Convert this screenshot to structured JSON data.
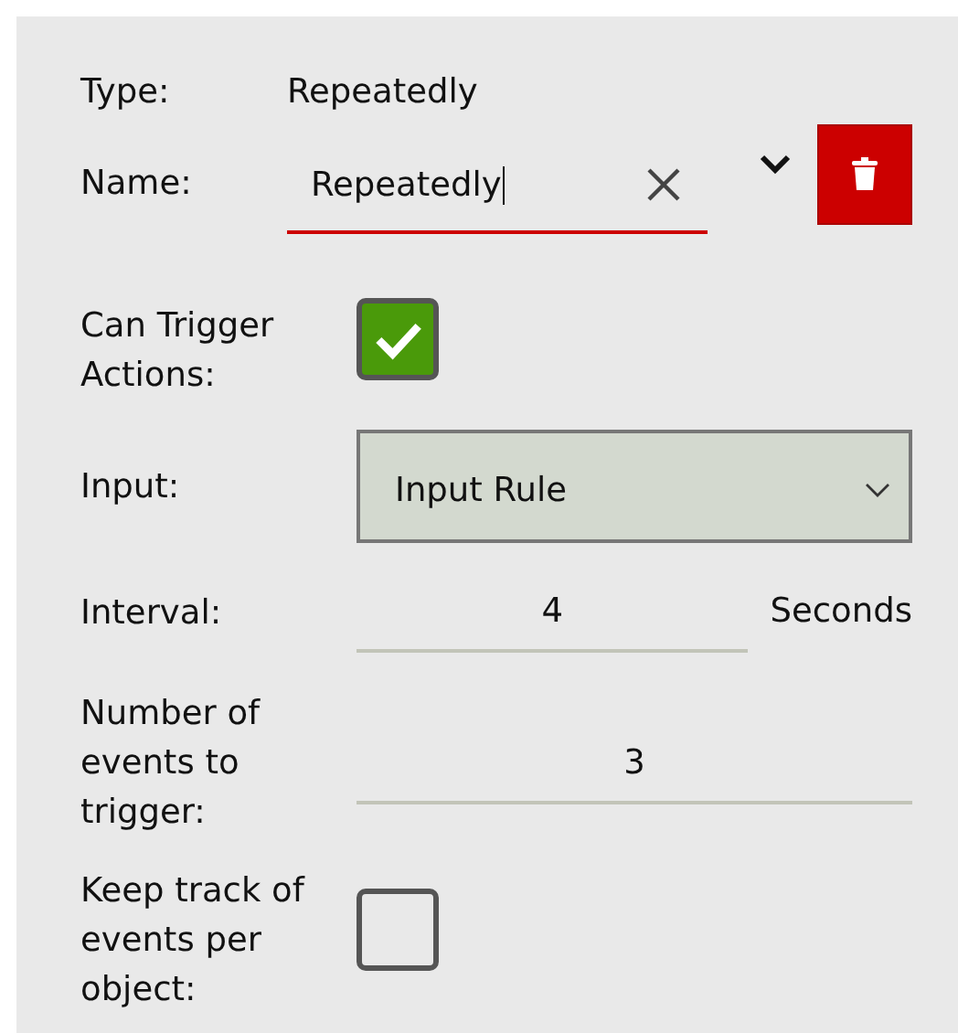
{
  "type": {
    "label": "Type:",
    "value": "Repeatedly"
  },
  "name": {
    "label": "Name:",
    "value": "Repeatedly",
    "error": true
  },
  "fields": [
    {
      "kind": "checkbox",
      "label": "Can Trigger Actions:",
      "checked": true
    },
    {
      "kind": "select",
      "label": "Input:",
      "value": "Input Rule"
    },
    {
      "kind": "number",
      "label": "Interval:",
      "value": "4",
      "unit": "Seconds"
    },
    {
      "kind": "number",
      "label": "Number of events to trigger:",
      "value": "3"
    },
    {
      "kind": "checkbox",
      "label": "Keep track of events per object:",
      "checked": false
    }
  ]
}
